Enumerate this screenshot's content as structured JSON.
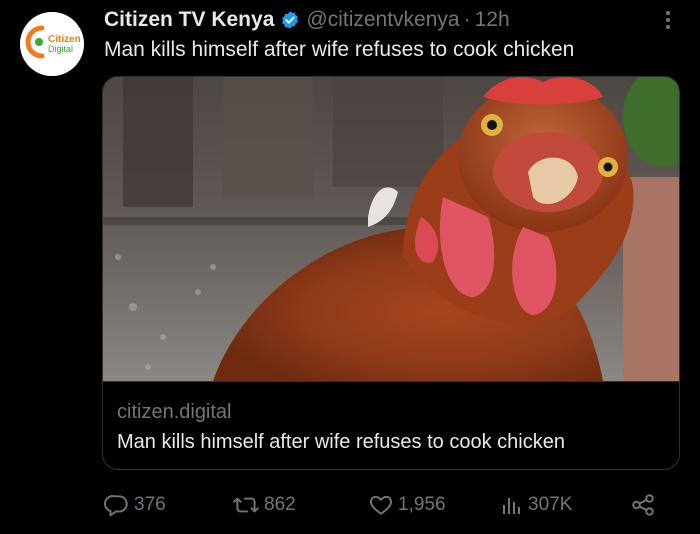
{
  "colors": {
    "background": "#000000",
    "text_primary": "#e7e9ea",
    "text_secondary": "#71767b",
    "verified_blue": "#1d9bf0",
    "border": "#2f3336",
    "brand_orange": "#f07b1f",
    "brand_green": "#3aa935"
  },
  "avatar": {
    "icon": "citizen-digital-logo",
    "text_line1": "Citizen",
    "text_line2": "Digital"
  },
  "header": {
    "display_name": "Citizen TV Kenya",
    "verified_icon": "verified-badge-icon",
    "handle": "@citizentvkenya",
    "separator": "·",
    "time": "12h",
    "more_icon": "more-icon"
  },
  "tweet": {
    "text": "Man kills himself after wife refuses to cook chicken"
  },
  "card": {
    "image": "chicken-photo",
    "domain": "citizen.digital",
    "title": "Man kills himself after wife refuses to cook chicken"
  },
  "actions": {
    "reply": {
      "icon": "reply-icon",
      "count": "376"
    },
    "retweet": {
      "icon": "retweet-icon",
      "count": "862"
    },
    "like": {
      "icon": "heart-icon",
      "count": "1,956"
    },
    "views": {
      "icon": "views-icon",
      "count": "307K"
    },
    "share": {
      "icon": "share-icon"
    }
  }
}
